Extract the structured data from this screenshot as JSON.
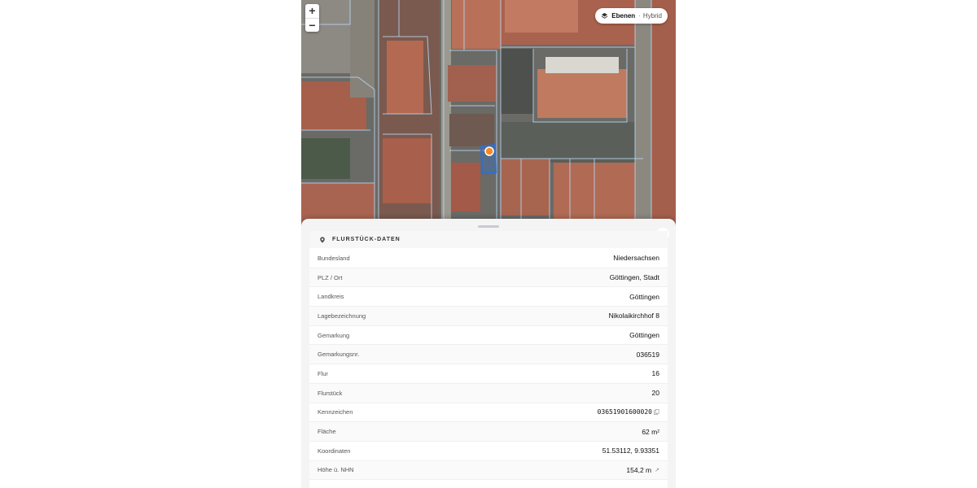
{
  "map": {
    "zoom_in_label": "+",
    "zoom_out_label": "−",
    "layers_label": "Ebenen",
    "layer_separator": "·",
    "layer_mode": "Hybrid",
    "marker_color": "#f28c28",
    "parcel_highlight_color": "#2f6fcf"
  },
  "panel": {
    "close_label": "×",
    "title": "FLURSTÜCK-DATEN",
    "rows": [
      {
        "key": "Bundesland",
        "value": "Niedersachsen"
      },
      {
        "key": "PLZ / Ort",
        "value": "Göttingen, Stadt"
      },
      {
        "key": "Landkreis",
        "value": "Göttingen"
      },
      {
        "key": "Lagebezeichnung",
        "value": "Nikolaikirchhof 8"
      },
      {
        "key": "Gemarkung",
        "value": "Göttingen"
      },
      {
        "key": "Gemarkungsnr.",
        "value": "036519"
      },
      {
        "key": "Flur",
        "value": "16"
      },
      {
        "key": "Flurstück",
        "value": "20"
      },
      {
        "key": "Kennzeichen",
        "value": "03651901600020"
      },
      {
        "key": "Fläche",
        "value": "62 m",
        "unit_sup": "2"
      },
      {
        "key": "Koordinaten",
        "value": "51.53112, 9.93351"
      },
      {
        "key": "Höhe ü. NHN",
        "value": "154,2 m",
        "suffix": "↗"
      }
    ]
  }
}
